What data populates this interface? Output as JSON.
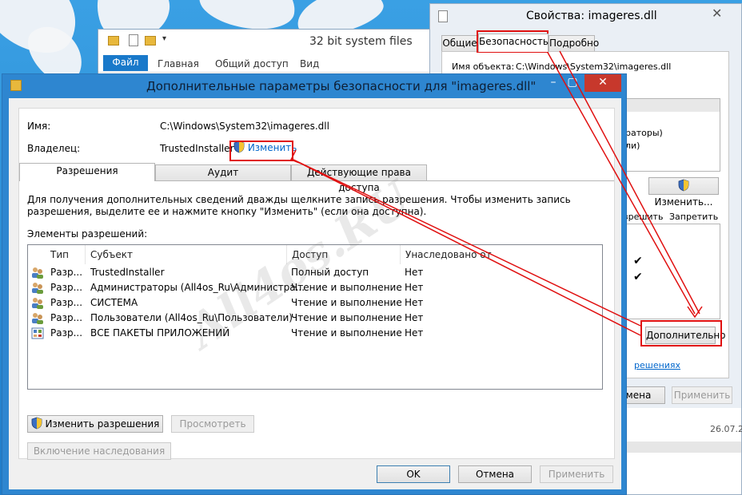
{
  "explorer": {
    "title": "32 bit system files",
    "tabs": [
      "Файл",
      "Главная",
      "Общий доступ",
      "Вид"
    ]
  },
  "properties": {
    "title": "Свойства: imageres.dll",
    "tabs": [
      "Общие",
      "Безопасность",
      "Подробно"
    ],
    "object_label": "Имя объекта:",
    "object_value": "C:\\Windows\\System32\\imageres.dll",
    "partial_groups": [
      "раторы)",
      "ли)"
    ],
    "change_button": "Изменить...",
    "allow_header": "азрешить",
    "deny_header": "Запретить",
    "advanced_button": "Дополнительно",
    "link_partial": "решениях",
    "cancel_partial": "тмена",
    "apply_button": "Применить",
    "date_partial": "26.07.20"
  },
  "dialog": {
    "title": "Дополнительные параметры безопасности  для \"imageres.dll\"",
    "name_label": "Имя:",
    "name_value": "C:\\Windows\\System32\\imageres.dll",
    "owner_label": "Владелец:",
    "owner_value": "TrustedInstaller",
    "owner_change": "Изменить",
    "tabs": [
      "Разрешения",
      "Аудит",
      "Действующие права доступа"
    ],
    "info_text": "Для получения дополнительных сведений дважды щелкните запись разрешения. Чтобы изменить запись разрешения, выделите ее и нажмите кнопку \"Изменить\" (если она доступна).",
    "entries_label": "Элементы разрешений:",
    "columns": [
      "Тип",
      "Субъект",
      "Доступ",
      "Унаследовано от"
    ],
    "rows": [
      {
        "type": "Разр...",
        "subject": "TrustedInstaller",
        "access": "Полный доступ",
        "inherited": "Нет",
        "icon": "users-icon"
      },
      {
        "type": "Разр...",
        "subject": "Администраторы (All4os_Ru\\Администра...",
        "access": "Чтение и выполнение",
        "inherited": "Нет",
        "icon": "users-icon"
      },
      {
        "type": "Разр...",
        "subject": "СИСТЕМА",
        "access": "Чтение и выполнение",
        "inherited": "Нет",
        "icon": "users-icon"
      },
      {
        "type": "Разр...",
        "subject": "Пользователи (All4os_Ru\\Пользователи)",
        "access": "Чтение и выполнение",
        "inherited": "Нет",
        "icon": "users-icon"
      },
      {
        "type": "Разр...",
        "subject": "ВСЕ ПАКЕТЫ ПРИЛОЖЕНИЙ",
        "access": "Чтение и выполнение",
        "inherited": "Нет",
        "icon": "app-packages-icon"
      }
    ],
    "change_permissions": "Изменить разрешения",
    "view": "Просмотреть",
    "enable_inheritance": "Включение наследования",
    "ok": "OK",
    "cancel": "Отмена",
    "apply": "Применить"
  },
  "watermark": "All4os.RU",
  "colors": {
    "accent": "#2e86d0",
    "annotation": "#e01010",
    "link": "#0066cc"
  }
}
